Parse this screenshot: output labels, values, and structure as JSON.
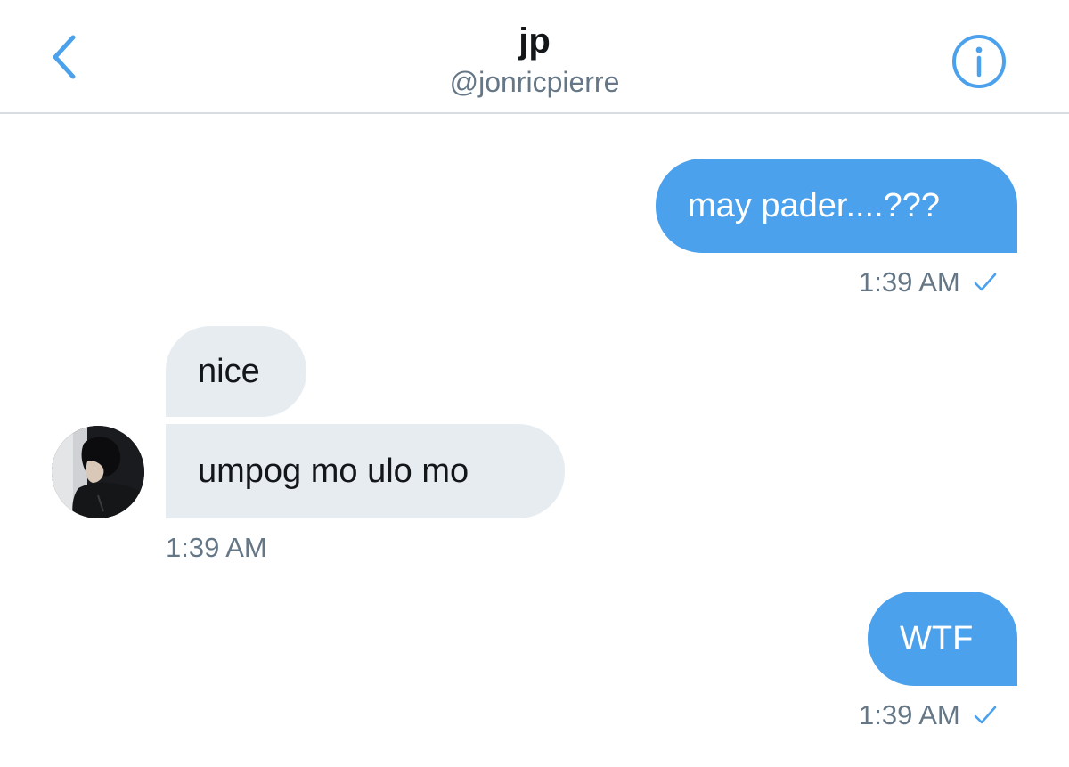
{
  "header": {
    "title": "jp",
    "handle": "@jonricpierre",
    "back_icon": "chevron-left-icon",
    "info_icon": "info-icon"
  },
  "colors": {
    "accent": "#4ca1ec",
    "received_bubble": "#e6ecf0",
    "timestamp": "#657786"
  },
  "messages": [
    {
      "direction": "sent",
      "text": "may pader....???"
    },
    {
      "direction": "received",
      "text": "nice"
    },
    {
      "direction": "received",
      "text": "umpog mo ulo mo"
    },
    {
      "direction": "sent",
      "text": "WTF"
    }
  ],
  "timestamps": {
    "first_sent": "1:39 AM",
    "received": "1:39 AM",
    "second_sent": "1:39 AM"
  }
}
